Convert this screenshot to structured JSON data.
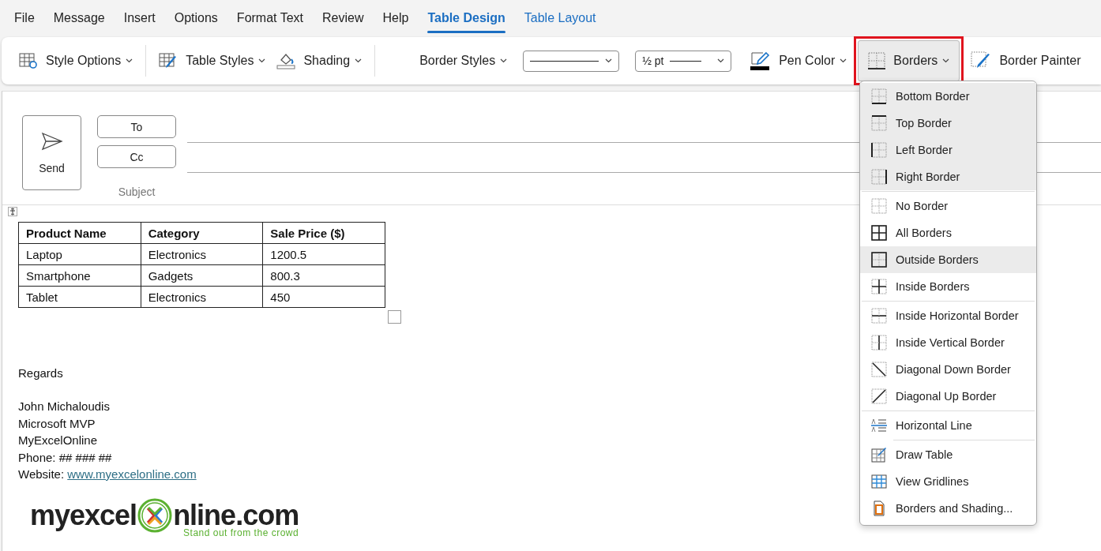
{
  "menu_tabs": [
    {
      "label": "File",
      "selected": false,
      "contextual": false
    },
    {
      "label": "Message",
      "selected": false,
      "contextual": false
    },
    {
      "label": "Insert",
      "selected": false,
      "contextual": false
    },
    {
      "label": "Options",
      "selected": false,
      "contextual": false
    },
    {
      "label": "Format Text",
      "selected": false,
      "contextual": false
    },
    {
      "label": "Review",
      "selected": false,
      "contextual": false
    },
    {
      "label": "Help",
      "selected": false,
      "contextual": false
    },
    {
      "label": "Table Design",
      "selected": true,
      "contextual": true
    },
    {
      "label": "Table Layout",
      "selected": false,
      "contextual": true
    }
  ],
  "ribbon": {
    "style_options": "Style Options",
    "table_styles": "Table Styles",
    "shading": "Shading",
    "border_styles": "Border Styles",
    "pen_weight": "½ pt",
    "pen_color": "Pen Color",
    "borders": {
      "label": "Borders",
      "pressed": true,
      "annotated": true
    },
    "border_painter": "Border Painter"
  },
  "message": {
    "send": "Send",
    "to": "To",
    "cc": "Cc",
    "subject": "Subject"
  },
  "table": {
    "columns": [
      "Product Name",
      "Category",
      "Sale Price ($)"
    ],
    "rows": [
      [
        "Laptop",
        "Electronics",
        "1200.5"
      ],
      [
        "Smartphone",
        "Gadgets",
        "800.3"
      ],
      [
        "Tablet",
        "Electronics",
        "450"
      ]
    ]
  },
  "body": {
    "closing": "Regards",
    "signature": [
      "John Michaloudis",
      "Microsoft MVP",
      "MyExcelOnline",
      "Phone: ## ### ##"
    ],
    "website_label": "Website:",
    "website_link": "www.myexcelonline.com"
  },
  "logo": {
    "left": "myexcel",
    "right": "nline.com",
    "tagline": "Stand out from the crowd"
  },
  "borders_menu": {
    "groups": [
      [
        {
          "label": "Bottom Border",
          "kind": "bottom",
          "highlighted": true
        },
        {
          "label": "Top Border",
          "kind": "top",
          "highlighted": true
        },
        {
          "label": "Left Border",
          "kind": "left",
          "highlighted": true
        },
        {
          "label": "Right Border",
          "kind": "right",
          "highlighted": true
        }
      ],
      [
        {
          "label": "No Border",
          "kind": "none",
          "highlighted": false
        },
        {
          "label": "All Borders",
          "kind": "all",
          "highlighted": false
        },
        {
          "label": "Outside Borders",
          "kind": "outside",
          "highlighted": true
        },
        {
          "label": "Inside Borders",
          "kind": "inside",
          "highlighted": false
        }
      ],
      [
        {
          "label": "Inside Horizontal Border",
          "kind": "inside_h",
          "highlighted": false
        },
        {
          "label": "Inside Vertical Border",
          "kind": "inside_v",
          "highlighted": false
        },
        {
          "label": "Diagonal Down Border",
          "kind": "diag_down",
          "highlighted": false
        },
        {
          "label": "Diagonal Up Border",
          "kind": "diag_up",
          "highlighted": false
        }
      ],
      [
        {
          "label": "Horizontal Line",
          "kind": "hline",
          "highlighted": false
        }
      ],
      [
        {
          "label": "Draw Table",
          "kind": "draw",
          "highlighted": false
        },
        {
          "label": "View Gridlines",
          "kind": "grid",
          "highlighted": false
        },
        {
          "label": "Borders and Shading...",
          "kind": "dialog",
          "highlighted": false
        }
      ]
    ]
  }
}
